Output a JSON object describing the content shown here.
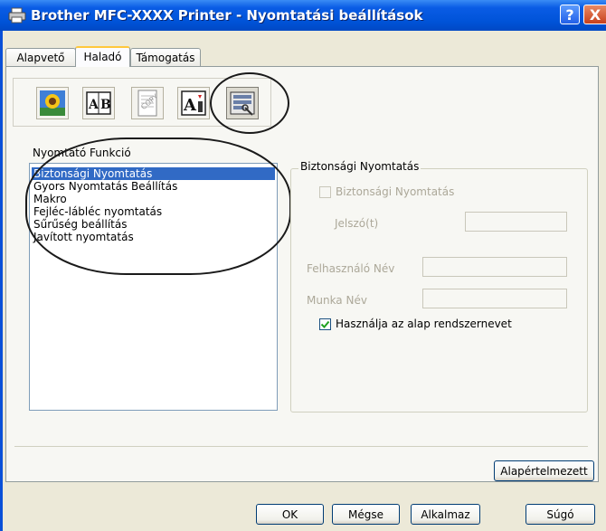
{
  "window": {
    "title": "Brother MFC-XXXX  Printer - Nyomtatási beállítások",
    "help_label": "?",
    "close_label": "X"
  },
  "tabs": [
    {
      "label": "Alapvető"
    },
    {
      "label": "Haladó"
    },
    {
      "label": "Támogatás"
    }
  ],
  "toolbar": {
    "tools": [
      "color-sunflower-icon",
      "ab-watermark-icon",
      "copy-page-icon",
      "text-scaling-icon",
      "device-options-icon"
    ],
    "text_ab": "A|B",
    "text_a": "A"
  },
  "functions": {
    "label": "Nyomtató Funkció",
    "items": [
      "Biztonsági Nyomtatás",
      "Gyors Nyomtatás Beállítás",
      "Makro",
      "Fejléc-lábléc nyomtatás",
      "Sűrűség beállítás",
      "Javított nyomtatás"
    ],
    "selected_index": 0
  },
  "secure_group": {
    "title": "Biztonsági Nyomtatás",
    "enable_checkbox_label": "Biztonsági Nyomtatás",
    "enable_checked": false,
    "password_label": "Jelszó(t)",
    "password_value": "",
    "username_label": "Felhasználó Név",
    "username_value": "",
    "jobname_label": "Munka Név",
    "jobname_value": "",
    "use_default_label": "Használja az alap rendszernevet",
    "use_default_checked": true
  },
  "buttons": {
    "default": "Alapértelmezett",
    "ok": "OK",
    "cancel": "Mégse",
    "apply": "Alkalmaz",
    "help": "Súgó"
  }
}
